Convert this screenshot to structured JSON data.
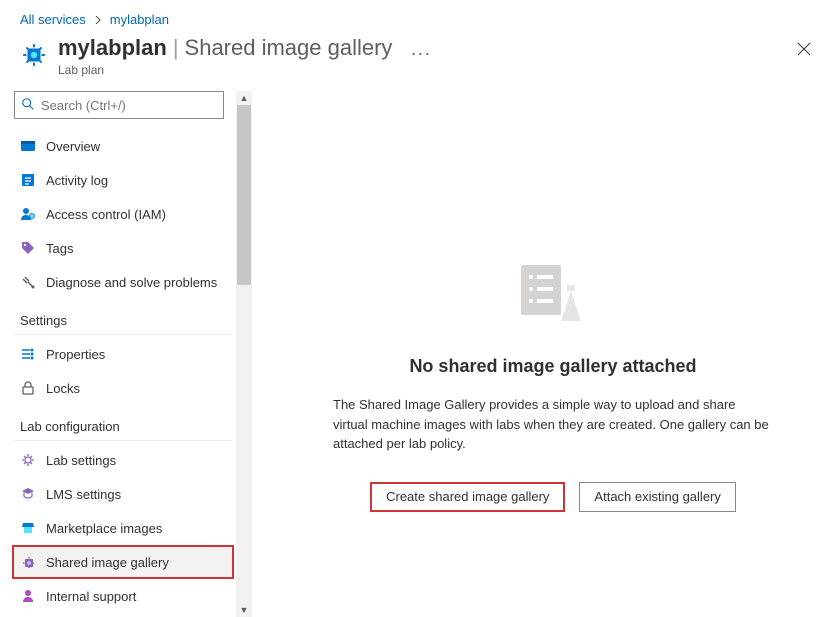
{
  "breadcrumb": {
    "root": "All services",
    "current": "mylabplan"
  },
  "header": {
    "name": "mylabplan",
    "section": "Shared image gallery",
    "subtitle": "Lab plan"
  },
  "sidebar": {
    "search_placeholder": "Search (Ctrl+/)",
    "items": [
      {
        "label": "Overview"
      },
      {
        "label": "Activity log"
      },
      {
        "label": "Access control (IAM)"
      },
      {
        "label": "Tags"
      },
      {
        "label": "Diagnose and solve problems"
      }
    ],
    "groups": [
      {
        "label": "Settings",
        "items": [
          {
            "label": "Properties"
          },
          {
            "label": "Locks"
          }
        ]
      },
      {
        "label": "Lab configuration",
        "items": [
          {
            "label": "Lab settings"
          },
          {
            "label": "LMS settings"
          },
          {
            "label": "Marketplace images"
          },
          {
            "label": "Shared image gallery"
          },
          {
            "label": "Internal support"
          }
        ]
      }
    ]
  },
  "main": {
    "empty_title": "No shared image gallery attached",
    "empty_desc": "The Shared Image Gallery provides a simple way to upload and share virtual machine images with labs when they are created. One gallery can be attached per lab policy.",
    "create_button": "Create shared image gallery",
    "attach_button": "Attach existing gallery"
  }
}
